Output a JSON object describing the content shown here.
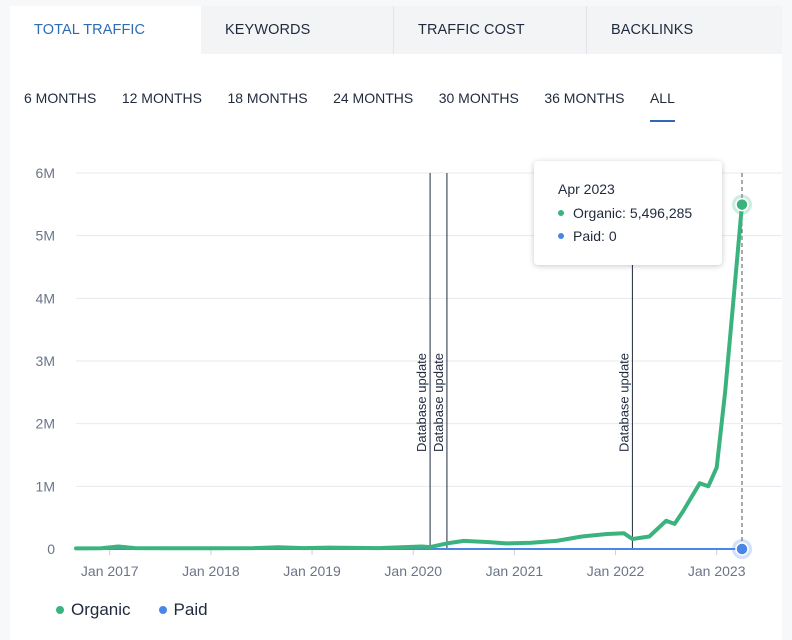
{
  "tabs": [
    {
      "label": "TOTAL TRAFFIC",
      "active": true
    },
    {
      "label": "KEYWORDS",
      "active": false
    },
    {
      "label": "TRAFFIC COST",
      "active": false
    },
    {
      "label": "BACKLINKS",
      "active": false
    }
  ],
  "ranges": [
    {
      "label": "6 MONTHS",
      "active": false
    },
    {
      "label": "12 MONTHS",
      "active": false
    },
    {
      "label": "18 MONTHS",
      "active": false
    },
    {
      "label": "24 MONTHS",
      "active": false
    },
    {
      "label": "30 MONTHS",
      "active": false
    },
    {
      "label": "36 MONTHS",
      "active": false
    },
    {
      "label": "ALL",
      "active": true
    }
  ],
  "tooltip": {
    "title": "Apr 2023",
    "organic_label": "Organic:",
    "organic_value": "5,496,285",
    "paid_label": "Paid:",
    "paid_value": "0"
  },
  "legend": {
    "organic": "Organic",
    "paid": "Paid"
  },
  "colors": {
    "organic": "#3bb37e",
    "paid": "#4a86e8",
    "accent": "#2d6cb5",
    "annotation": "#1f2a3d"
  },
  "chart_data": {
    "type": "line",
    "x_axis": {
      "type": "date",
      "range": [
        "2016-09",
        "2023-04"
      ],
      "ticks": [
        {
          "date": "2017-01",
          "label": "Jan 2017"
        },
        {
          "date": "2018-01",
          "label": "Jan 2018"
        },
        {
          "date": "2019-01",
          "label": "Jan 2019"
        },
        {
          "date": "2020-01",
          "label": "Jan 2020"
        },
        {
          "date": "2021-01",
          "label": "Jan 2021"
        },
        {
          "date": "2022-01",
          "label": "Jan 2022"
        },
        {
          "date": "2023-01",
          "label": "Jan 2023"
        }
      ]
    },
    "y_axis": {
      "range": [
        0,
        6000000
      ],
      "ticks": [
        {
          "value": 0,
          "label": "0"
        },
        {
          "value": 1000000,
          "label": "1M"
        },
        {
          "value": 2000000,
          "label": "2M"
        },
        {
          "value": 3000000,
          "label": "3M"
        },
        {
          "value": 4000000,
          "label": "4M"
        },
        {
          "value": 5000000,
          "label": "5M"
        },
        {
          "value": 6000000,
          "label": "6M"
        }
      ]
    },
    "grid": true,
    "legend_position": "bottom-left",
    "annotations": [
      {
        "date": "2020-03",
        "label": "Database update"
      },
      {
        "date": "2020-05",
        "label": "Database update"
      },
      {
        "date": "2022-03",
        "label": "Database update"
      }
    ],
    "highlight": {
      "date": "2023-04"
    },
    "series": [
      {
        "name": "Organic",
        "points": [
          [
            "2016-09",
            10000
          ],
          [
            "2016-12",
            12000
          ],
          [
            "2017-02",
            40000
          ],
          [
            "2017-04",
            15000
          ],
          [
            "2017-08",
            12000
          ],
          [
            "2018-01",
            13000
          ],
          [
            "2018-06",
            15000
          ],
          [
            "2018-09",
            28000
          ],
          [
            "2018-12",
            15000
          ],
          [
            "2019-03",
            22000
          ],
          [
            "2019-06",
            18000
          ],
          [
            "2019-09",
            15000
          ],
          [
            "2019-12",
            30000
          ],
          [
            "2020-02",
            40000
          ],
          [
            "2020-03",
            30000
          ],
          [
            "2020-05",
            90000
          ],
          [
            "2020-07",
            130000
          ],
          [
            "2020-10",
            110000
          ],
          [
            "2020-12",
            90000
          ],
          [
            "2021-03",
            100000
          ],
          [
            "2021-06",
            130000
          ],
          [
            "2021-09",
            200000
          ],
          [
            "2021-12",
            240000
          ],
          [
            "2022-02",
            250000
          ],
          [
            "2022-03",
            160000
          ],
          [
            "2022-05",
            200000
          ],
          [
            "2022-07",
            450000
          ],
          [
            "2022-08",
            400000
          ],
          [
            "2022-09",
            600000
          ],
          [
            "2022-11",
            1050000
          ],
          [
            "2022-12",
            1000000
          ],
          [
            "2023-01",
            1300000
          ],
          [
            "2023-02",
            2500000
          ],
          [
            "2023-03",
            4000000
          ],
          [
            "2023-04",
            5496285
          ]
        ]
      },
      {
        "name": "Paid",
        "points": [
          [
            "2016-09",
            0
          ],
          [
            "2023-04",
            0
          ]
        ]
      }
    ]
  }
}
